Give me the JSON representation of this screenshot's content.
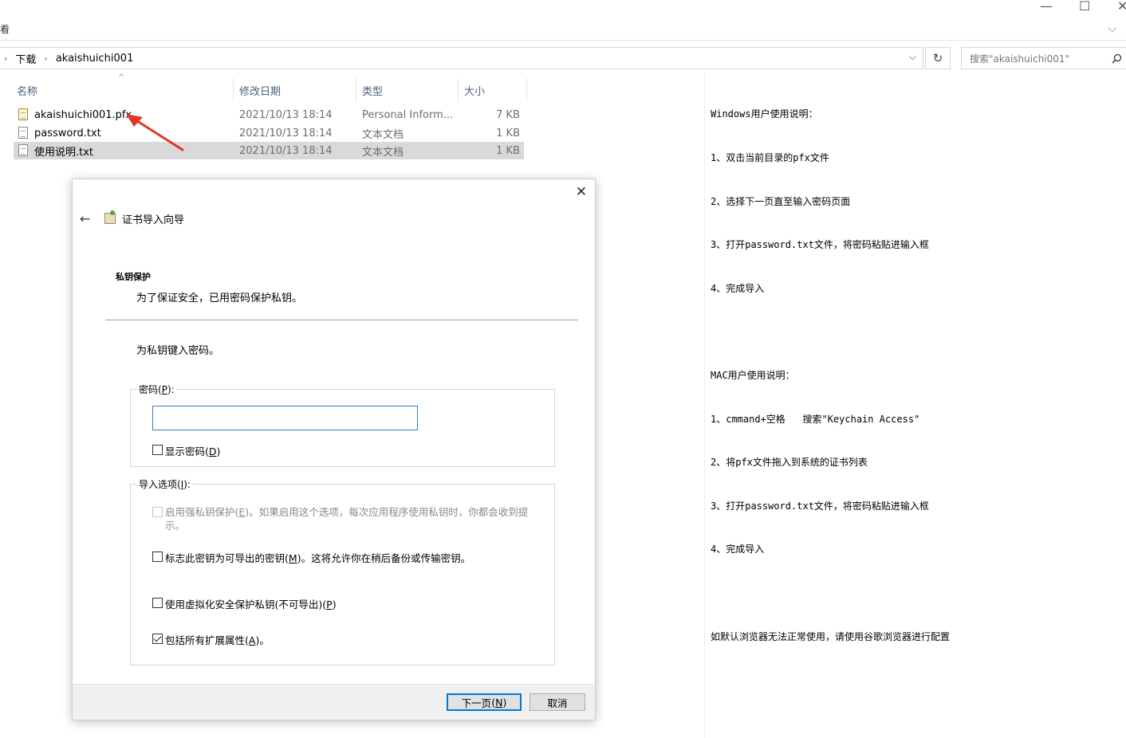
{
  "window": {
    "minimize_glyph": "—",
    "maximize_glyph": "☐",
    "close_glyph": "✕"
  },
  "ribbon": {
    "hint": "看",
    "expand_glyph": "⌵"
  },
  "address": {
    "crumbs": [
      "下载",
      "akaishuichi001"
    ],
    "separator": "›",
    "dropdown_glyph": "⌵",
    "refresh_glyph": "↻"
  },
  "search": {
    "placeholder": "搜索\"akaishuichi001\"",
    "icon": "search-icon"
  },
  "file_list": {
    "columns": {
      "name": "名称",
      "date": "修改日期",
      "type": "类型",
      "size": "大小"
    },
    "sort_glyph": "^",
    "rows": [
      {
        "name": "akaishuichi001.pfx",
        "date": "2021/10/13 18:14",
        "type": "Personal Inform...",
        "size": "7 KB",
        "selected": false
      },
      {
        "name": "password.txt",
        "date": "2021/10/13 18:14",
        "type": "文本文档",
        "size": "1 KB",
        "selected": false
      },
      {
        "name": "使用说明.txt",
        "date": "2021/10/13 18:14",
        "type": "文本文档",
        "size": "1 KB",
        "selected": true
      }
    ]
  },
  "notes": {
    "lines": [
      "Windows用户使用说明：",
      "1、双击当前目录的pfx文件",
      "2、选择下一页直至输入密码页面",
      "3、打开password.txt文件，将密码粘贴进输入框",
      "4、完成导入",
      "",
      "MAC用户使用说明：",
      "1、cmmand+空格   搜索\"Keychain Access\"",
      "2、将pfx文件拖入到系统的证书列表",
      "3、打开password.txt文件，将密码粘贴进输入框",
      "4、完成导入",
      "",
      "如默认浏览器无法正常使用，请使用谷歌浏览器进行配置"
    ]
  },
  "dialog": {
    "close_glyph": "✕",
    "back_glyph": "←",
    "title": "证书导入向导",
    "heading": "私钥保护",
    "subheading": "为了保证安全，已用密码保护私钥。",
    "prompt": "为私钥键入密码。",
    "password_group": {
      "label": "密码",
      "label_key": "P",
      "label_open": "(",
      "label_close": "):",
      "value": "",
      "show_password_text": "显示密码",
      "show_password_key": "D",
      "show_password_checked": false
    },
    "options_group": {
      "label": "导入选项",
      "label_key": "I",
      "label_open": "(",
      "label_close": "):",
      "strong_protection_pre": "启用强私钥保护",
      "strong_protection_key": "E",
      "strong_protection_post": "。如果启用这个选项，每次应用程序使用私钥时，你都会收到提示。",
      "exportable_pre": "标志此密钥为可导出的密钥",
      "exportable_key": "M",
      "exportable_post": "。这将允许你在稍后备份或传输密钥。",
      "vbs_pre": "使用虚拟化安全保护私钥(不可导出)",
      "vbs_key": "P",
      "extended_pre": "包括所有扩展属性",
      "extended_key": "A",
      "extended_post": "。",
      "key_open": "(",
      "key_close": ")"
    },
    "buttons": {
      "next_pre": "下一页",
      "next_key": "N",
      "cancel": "取消"
    }
  },
  "colors": {
    "accent": "#0078d7",
    "input_border": "#3c7bd0",
    "selected_row": "#d9d9d9",
    "arrow": "#e0352b",
    "column_header": "#4c607a"
  }
}
